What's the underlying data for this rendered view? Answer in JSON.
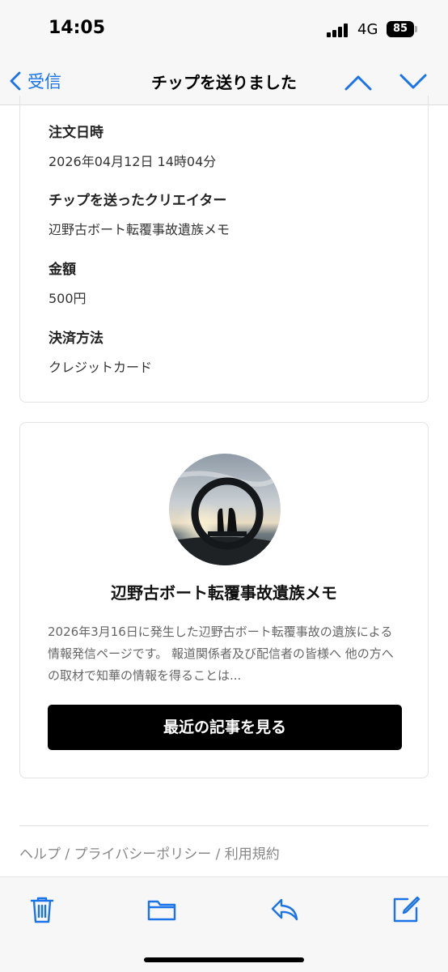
{
  "status": {
    "time": "14:05",
    "network": "4G",
    "battery": "85"
  },
  "nav": {
    "back_label": "受信",
    "title": "チップを送りました"
  },
  "details": [
    {
      "label": "注文日時",
      "value": "2026年04月12日 14時04分"
    },
    {
      "label": "チップを送ったクリエイター",
      "value": "辺野古ボート転覆事故遺族メモ"
    },
    {
      "label": "金額",
      "value": "500円"
    },
    {
      "label": "決済方法",
      "value": "クレジットカード"
    }
  ],
  "creator": {
    "name": "辺野古ボート転覆事故遺族メモ",
    "description": "2026年3月16日に発生した辺野古ボート転覆事故の遺族による情報発信ページです。 報道関係者及び配信者の皆様へ 他の方への取材で知華の情報を得ることは...",
    "button_label": "最近の記事を見る"
  },
  "footer": {
    "help": "ヘルプ",
    "privacy": "プライバシーポリシー",
    "terms": "利用規約",
    "separator": " / "
  },
  "colors": {
    "accent": "#1a73e8",
    "button_bg": "#000000"
  },
  "toolbar": {
    "icons": [
      "trash-icon",
      "folder-icon",
      "reply-icon",
      "compose-icon"
    ]
  }
}
